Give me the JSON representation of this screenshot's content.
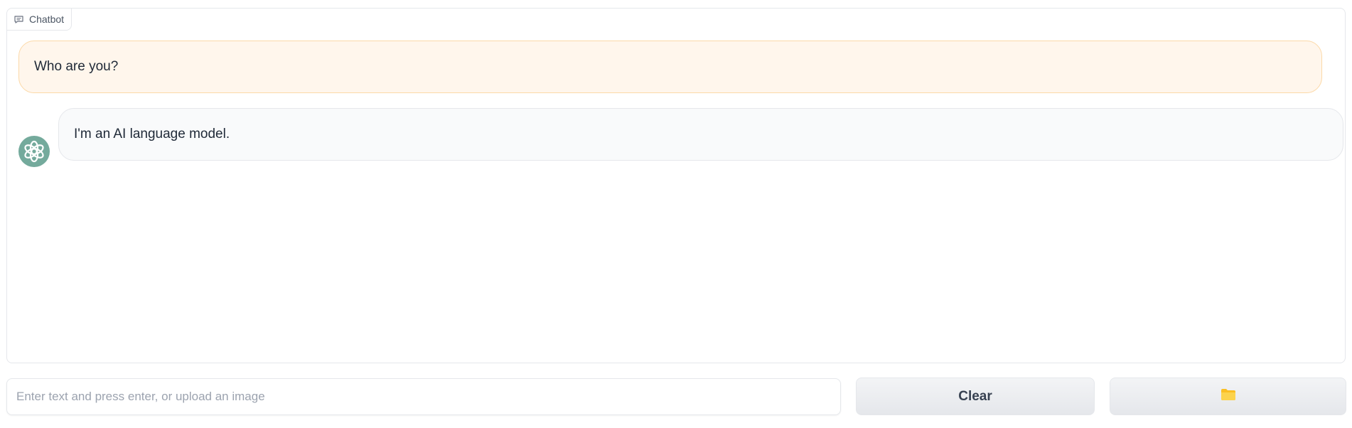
{
  "panel": {
    "label": "Chatbot",
    "label_icon": "chat-bubble-icon"
  },
  "messages": [
    {
      "role": "user",
      "text": "Who are you?"
    },
    {
      "role": "bot",
      "text": "I'm an AI language model.",
      "avatar_icon": "openai-logo-icon"
    }
  ],
  "input": {
    "value": "",
    "placeholder": "Enter text and press enter, or upload an image"
  },
  "buttons": {
    "clear_label": "Clear",
    "upload_icon": "folder-icon"
  },
  "colors": {
    "user_bubble_bg": "#fff6ec",
    "user_bubble_border": "#fcd9a8",
    "bot_bubble_bg": "#f9fafb",
    "avatar_bg": "#74aa9c",
    "folder_icon": "#fbbf24"
  }
}
